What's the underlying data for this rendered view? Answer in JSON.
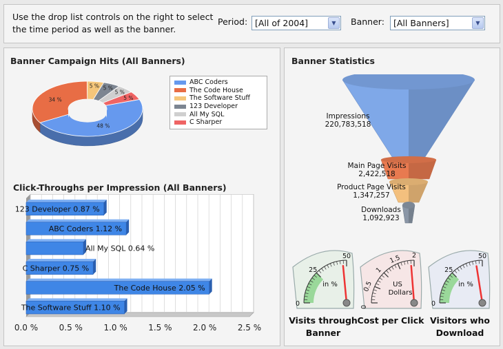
{
  "header": {
    "intro_line1": "Use the drop list controls on the right to select",
    "intro_line2": "the time period as well as the banner.",
    "period_label": "Period:",
    "period_value": "[All of 2004]",
    "banner_label": "Banner:",
    "banner_value": "[All Banners]"
  },
  "pie": {
    "title": "Banner Campaign Hits (All Banners)",
    "legend": [
      {
        "name": "ABC Coders",
        "color": "#6699ee"
      },
      {
        "name": "The Code House",
        "color": "#e86d45"
      },
      {
        "name": "The Software Stuff",
        "color": "#f5c67a"
      },
      {
        "name": "123 Developer",
        "color": "#7c8591"
      },
      {
        "name": "All My SQL",
        "color": "#cfcfcf"
      },
      {
        "name": "C Sharper",
        "color": "#ef6464"
      }
    ],
    "chart_data": {
      "type": "pie",
      "slices": [
        {
          "label": "48 %",
          "value": 48
        },
        {
          "label": "34 %",
          "value": 34
        },
        {
          "label": "5 %",
          "value": 5
        },
        {
          "label": "5 %",
          "value": 5
        },
        {
          "label": "5 %",
          "value": 5
        },
        {
          "label": "5 %",
          "value": 5
        }
      ]
    }
  },
  "bar": {
    "title": "Click-Throughs per Impression (All Banners)",
    "chart_data": {
      "type": "bar",
      "orientation": "horizontal",
      "categories": [
        "123 Developer",
        "ABC Coders",
        "All My SQL",
        "C Sharper",
        "The Code House",
        "The Software Stuff"
      ],
      "values": [
        0.87,
        1.12,
        0.64,
        0.75,
        2.05,
        1.1
      ],
      "labels": [
        "123 Developer  0.87 %",
        "ABC Coders  1.12 %",
        "All My SQL  0.64 %",
        "C Sharper  0.75 %",
        "The Code House  2.05 %",
        "The Software Stuff  1.10 %"
      ],
      "xlim": [
        0,
        2.5
      ],
      "xticks": [
        "0.0 %",
        "0.5 %",
        "1.0 %",
        "1.5 %",
        "2.0 %",
        "2.5 %"
      ],
      "grid": true
    }
  },
  "stats": {
    "title": "Banner Statistics",
    "funnel": {
      "type": "funnel",
      "stages": [
        {
          "label": "Impressions",
          "value": "220,783,518",
          "color": "#7fa8e8"
        },
        {
          "label": "Main Page Visits",
          "value": "2,422,518",
          "color": "#e87a50"
        },
        {
          "label": "Product Page Visits",
          "value": "1,347,257",
          "color": "#f3c07e"
        },
        {
          "label": "Downloads",
          "value": "1,092,923",
          "color": "#8a96a6"
        }
      ]
    },
    "gauges": [
      {
        "label_line1": "Visits through",
        "label_line2": "Banner",
        "unit1": "in %",
        "unit2": "",
        "max_label": "50",
        "mid_label": "25",
        "min_label": "0",
        "value": 47,
        "green_from": 0,
        "green_to": 25,
        "bg": "#e8f0e8"
      },
      {
        "label_line1": "Cost per Click",
        "label_line2": "",
        "unit1": "US",
        "unit2": "Dollars",
        "max_label": "2",
        "mid_label": "1",
        "ticks": [
          "0",
          "0.5",
          "1",
          "1.5",
          "2"
        ],
        "value": 1.9,
        "bg": "#f6e6e6"
      },
      {
        "label_line1": "Visitors who",
        "label_line2": "Download",
        "unit1": "in %",
        "unit2": "",
        "max_label": "50",
        "mid_label": "25",
        "min_label": "0",
        "value": 45,
        "green_from": 0,
        "green_to": 25,
        "bg": "#e8ebf4"
      }
    ]
  }
}
